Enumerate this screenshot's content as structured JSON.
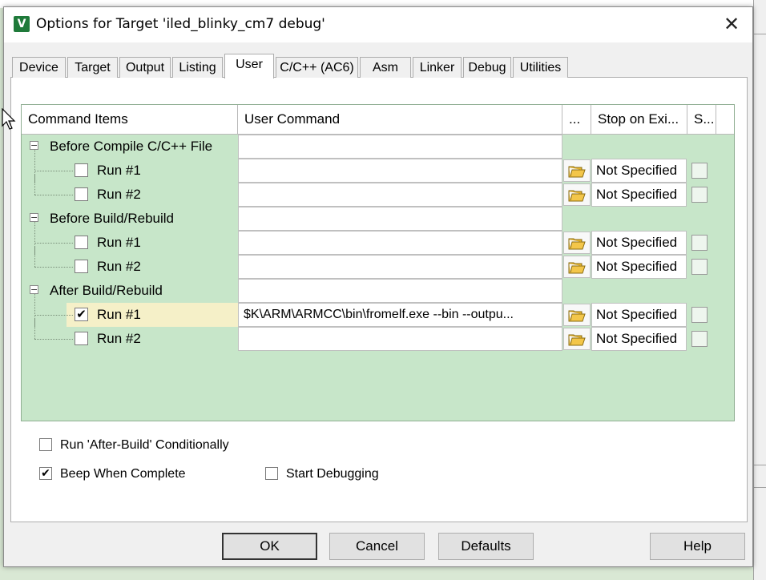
{
  "window": {
    "title": "Options for Target 'iled_blinky_cm7 debug'",
    "app_icon": "V",
    "close_glyph": "✕"
  },
  "tabs": [
    {
      "label": "Device"
    },
    {
      "label": "Target"
    },
    {
      "label": "Output"
    },
    {
      "label": "Listing"
    },
    {
      "label": "User",
      "active": true
    },
    {
      "label": "C/C++ (AC6)"
    },
    {
      "label": "Asm"
    },
    {
      "label": "Linker"
    },
    {
      "label": "Debug"
    },
    {
      "label": "Utilities"
    }
  ],
  "grid": {
    "headers": {
      "items": "Command Items",
      "command": "User Command",
      "browse": "...",
      "stop": "Stop on Exi...",
      "s": "S..."
    },
    "rows": [
      {
        "type": "group",
        "label": "Before Compile C/C++ File",
        "expander": "−"
      },
      {
        "type": "item",
        "label": "Run #1",
        "checked": false,
        "command": "",
        "stop": "Not Specified"
      },
      {
        "type": "item",
        "label": "Run #2",
        "checked": false,
        "command": "",
        "stop": "Not Specified"
      },
      {
        "type": "group",
        "label": "Before Build/Rebuild",
        "expander": "−"
      },
      {
        "type": "item",
        "label": "Run #1",
        "checked": false,
        "command": "",
        "stop": "Not Specified"
      },
      {
        "type": "item",
        "label": "Run #2",
        "checked": false,
        "command": "",
        "stop": "Not Specified"
      },
      {
        "type": "group",
        "label": "After Build/Rebuild",
        "expander": "−"
      },
      {
        "type": "item",
        "label": "Run #1",
        "checked": true,
        "command": "$K\\ARM\\ARMCC\\bin\\fromelf.exe --bin --outpu...",
        "stop": "Not Specified",
        "highlight": true
      },
      {
        "type": "item",
        "label": "Run #2",
        "checked": false,
        "command": "",
        "stop": "Not Specified"
      }
    ]
  },
  "options": {
    "run_after_build": {
      "label": "Run 'After-Build' Conditionally",
      "checked": false
    },
    "beep": {
      "label": "Beep When Complete",
      "checked": true
    },
    "start_debugging": {
      "label": "Start Debugging",
      "checked": false
    }
  },
  "buttons": {
    "ok": "OK",
    "cancel": "Cancel",
    "defaults": "Defaults",
    "help": "Help"
  },
  "checkmark": "✔",
  "colors": {
    "grid_bg": "#c7e6c9",
    "highlight": "#f5f0c8",
    "dialog_bg": "#f0f0f0"
  }
}
